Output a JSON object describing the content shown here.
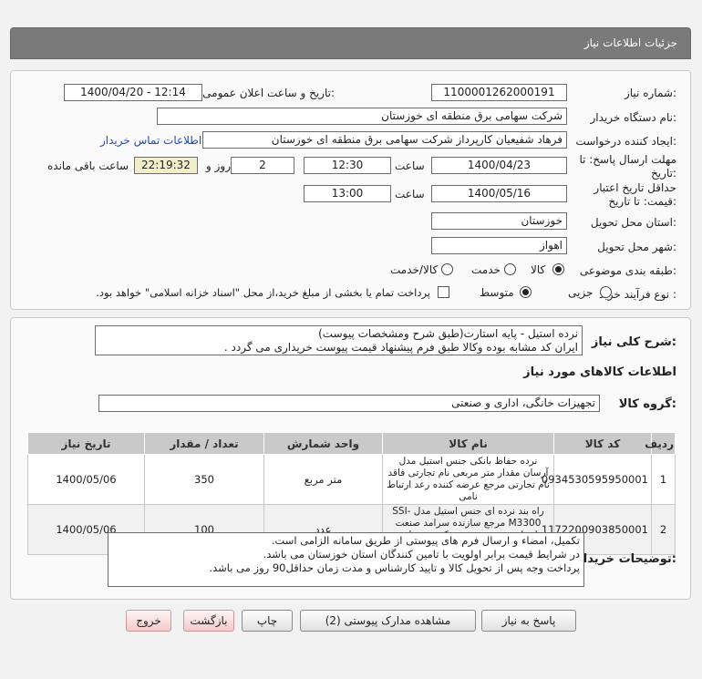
{
  "title": "جزئیات اطلاعات نیاز",
  "form": {
    "need_number_label": "شماره نیاز:",
    "need_number": "1100001262000191",
    "announce_label": "تاریخ و ساعت اعلان عمومی:",
    "announce_value": "1400/04/20 - 12:14",
    "buyer_label": "نام دستگاه خریدار:",
    "buyer_value": "شرکت سهامی برق منطقه ای خوزستان",
    "creator_label": "ایجاد کننده درخواست:",
    "creator_value": "فرهاد شفیعیان کارپرداز شرکت سهامی برق منطقه ای خوزستان",
    "contact_link": "اطلاعات تماس خریدار",
    "deadline_label_1": "مهلت ارسال پاسخ: تا",
    "deadline_label_2": "تاریخ:",
    "deadline_date": "1400/04/23",
    "time_label": "ساعت",
    "deadline_time": "12:30",
    "days_value": "2",
    "days_label": "روز و",
    "remaining_value": "22:19:32",
    "remaining_label": "ساعت باقی مانده",
    "validity_label_1": "حداقل تاریخ اعتبار",
    "validity_label_2": "قیمت: تا تاریخ:",
    "validity_date": "1400/05/16",
    "validity_time": "13:00",
    "province_label": "استان محل تحویل:",
    "province_value": "خوزستان",
    "city_label": "شهر محل تحویل:",
    "city_value": "اهواز",
    "category_label": "طبقه بندی موضوعی:",
    "cat_goods": "کالا",
    "cat_service": "خدمت",
    "cat_both": "کالا/خدمت",
    "process_label": "نوع فرآیند خرید :",
    "proc_partial": "جزیی",
    "proc_medium": "متوسط",
    "payment_note": "پرداخت تمام یا بخشی از مبلغ خرید،از محل \"اسناد خزانه اسلامی\" خواهد بود."
  },
  "description": {
    "label": "شرح کلی نیاز:",
    "text": "نرده استیل - پایه استارت(طبق شرح ومشخصات پیوست)\nایران کد مشابه بوده وکالا طبق فرم پیشنهاد قیمت پیوست خریداری می گردد ."
  },
  "goods_section": {
    "title": "اطلاعات کالاهای مورد نیاز",
    "group_label": "گروه کالا:",
    "group_value": "تجهیزات خانگی، اداری و صنعتی"
  },
  "table": {
    "headers": [
      "ردیف",
      "کد کالا",
      "نام کالا",
      "واحد شمارش",
      "تعداد / مقدار",
      "تاریخ نیاز"
    ],
    "rows": [
      {
        "row": "1",
        "code": "0934530595950001",
        "name": "نرده حفاظ بانکی جنس استیل مدل آرسان مقدار متر مربعی نام تجارتی فاقد نام تجارتی مرجع عرضه کننده رعد ارتباط نامی",
        "unit": "متر مربع",
        "qty": "350",
        "date": "1400/05/06"
      },
      {
        "row": "2",
        "code": "1172200903850001",
        "name": "راه بند نرده ای جنس استیل مدل SSI-M3300 مرجع سازنده سرامد صنعت ایساتیس مرجع عرضه کننده سرامد صنعت ایساتیس",
        "unit": "عدد",
        "qty": "100",
        "date": "1400/05/06"
      }
    ]
  },
  "notes": {
    "label": "توضیحات خریدار:",
    "text": "تکمیل، امضاء و ارسال فرم های پیوستی از طریق سامانه الزامی است.\nدر شرایط  قیمت برابر اولویت با تامین کنندگان استان خوزستان می باشد.\nپرداخت وجه پس از تحویل کالا و تایید کارشناس و مدت زمان حداقل90 روز می باشد."
  },
  "buttons": {
    "reply": "پاسخ به نیاز",
    "attachments": "مشاهده مدارک پیوستی (2)",
    "print": "چاپ",
    "back": "بازگشت",
    "exit": "خروج"
  }
}
